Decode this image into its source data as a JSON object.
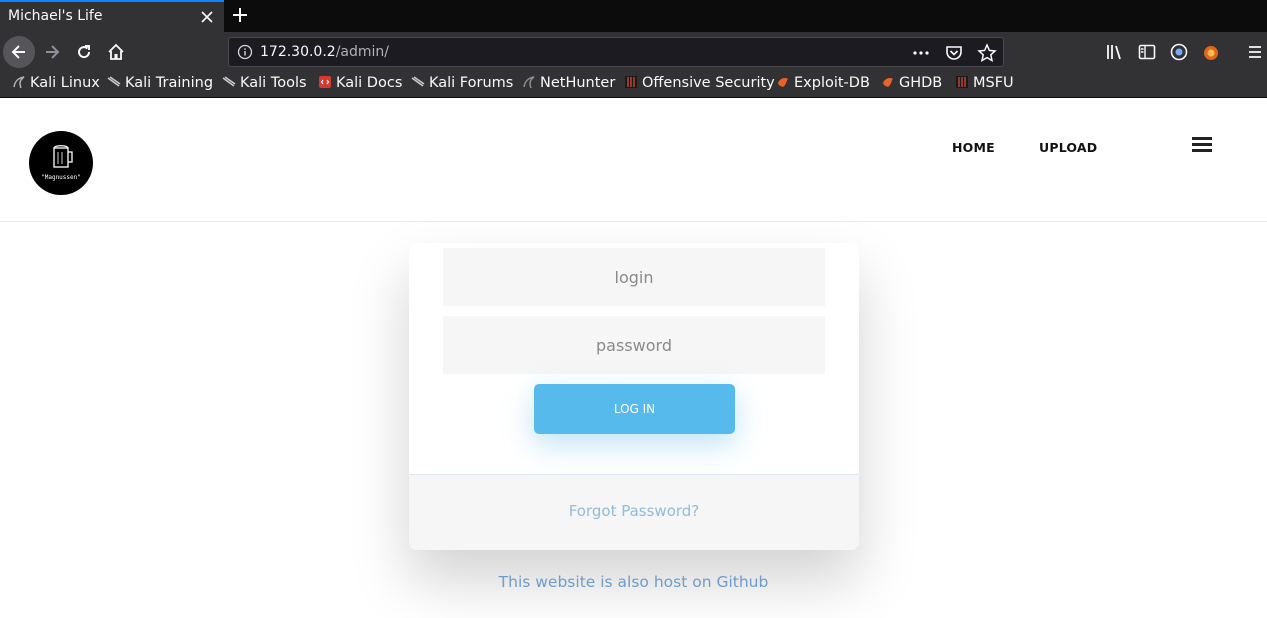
{
  "browser": {
    "tab_title": "Michael's Life",
    "url_host": "172.30.0.2",
    "url_path": "/admin/",
    "bookmarks": [
      {
        "label": "Kali Linux",
        "icon": "kali-dragon-icon"
      },
      {
        "label": "Kali Training",
        "icon": "kali-dragon-icon"
      },
      {
        "label": "Kali Tools",
        "icon": "kali-dragon-icon"
      },
      {
        "label": "Kali Docs",
        "icon": "kali-docs-icon"
      },
      {
        "label": "Kali Forums",
        "icon": "kali-dragon-icon"
      },
      {
        "label": "NetHunter",
        "icon": "nethunter-icon"
      },
      {
        "label": "Offensive Security",
        "icon": "offsec-icon"
      },
      {
        "label": "Exploit-DB",
        "icon": "exploit-db-icon"
      },
      {
        "label": "GHDB",
        "icon": "exploit-db-icon"
      },
      {
        "label": "MSFU",
        "icon": "offsec-icon"
      }
    ]
  },
  "site": {
    "logo_text": "\"Magnussen\"",
    "nav": {
      "home": "HOME",
      "upload": "UPLOAD"
    }
  },
  "form": {
    "login_placeholder": "login",
    "password_placeholder": "password",
    "submit_label": "LOG IN",
    "forgot_label": "Forgot Password?"
  },
  "footer": {
    "github_text": "This website is also host on Github"
  },
  "colors": {
    "accent": "#56baed",
    "link": "#92badd",
    "chrome_dark": "#323234"
  }
}
